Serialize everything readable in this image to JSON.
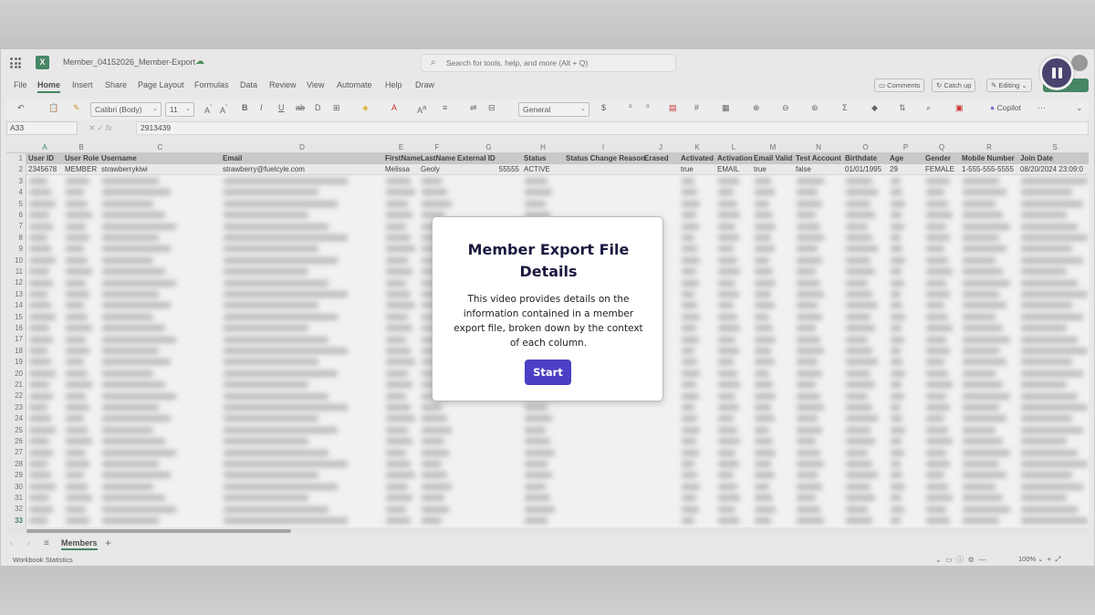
{
  "titlebar": {
    "doc_title": "Member_04152026_Member-Export",
    "search_placeholder": "Search for tools, help, and more (Alt + Q)"
  },
  "menu": [
    "File",
    "Home",
    "Insert",
    "Share",
    "Page Layout",
    "Formulas",
    "Data",
    "Review",
    "View",
    "Automate",
    "Help",
    "Draw"
  ],
  "menu_active": "Home",
  "ribbon_right": {
    "comments": "Comments",
    "catch_up": "Catch up",
    "editing": "Editing"
  },
  "toolbar": {
    "font_name": "Calibri (Body)",
    "font_size": "11",
    "number_format": "General",
    "copilot": "Copilot"
  },
  "formula_bar": {
    "name_box": "A33",
    "formula": "2913439",
    "fx": "fx"
  },
  "columns": [
    "A",
    "B",
    "C",
    "D",
    "E",
    "F",
    "G",
    "H",
    "I",
    "J",
    "K",
    "L",
    "M",
    "N",
    "O",
    "P",
    "Q",
    "R",
    "S"
  ],
  "header_row": [
    "User ID",
    "User Role",
    "Username",
    "Email",
    "FirstName",
    "LastName",
    "External ID",
    "Status",
    "Status Change Reason",
    "Erased",
    "Activated",
    "Activation",
    "Email Valid",
    "Test Account",
    "Birthdate",
    "Age",
    "Gender",
    "Mobile Number",
    "Join Date"
  ],
  "data_row": [
    "2345678",
    "MEMBER",
    "strawberrykiwi",
    "strawberry@fuelcyle.com",
    "Melissa",
    "Geoly",
    "55555",
    "ACTIVE",
    "",
    "",
    "true",
    "EMAIL",
    "true",
    "false",
    "01/01/1995",
    "29",
    "FEMALE",
    "1-555-555-5555",
    "08/20/2024 23:09:0"
  ],
  "row_numbers": [
    "1",
    "2",
    "3",
    "4",
    "5",
    "6",
    "7",
    "8",
    "9",
    "10",
    "11",
    "12",
    "13",
    "14",
    "15",
    "16",
    "17",
    "18",
    "19",
    "20",
    "21",
    "22",
    "23",
    "24",
    "25",
    "26",
    "27",
    "28",
    "29",
    "30",
    "31",
    "32",
    "33"
  ],
  "sheet_tab": "Members",
  "status": {
    "left": "Workbook Statistics",
    "zoom": "100%"
  },
  "modal": {
    "title": "Member Export File Details",
    "body": "This video provides details on the information contained in a member export file, broken down by the context of each column.",
    "start": "Start"
  }
}
